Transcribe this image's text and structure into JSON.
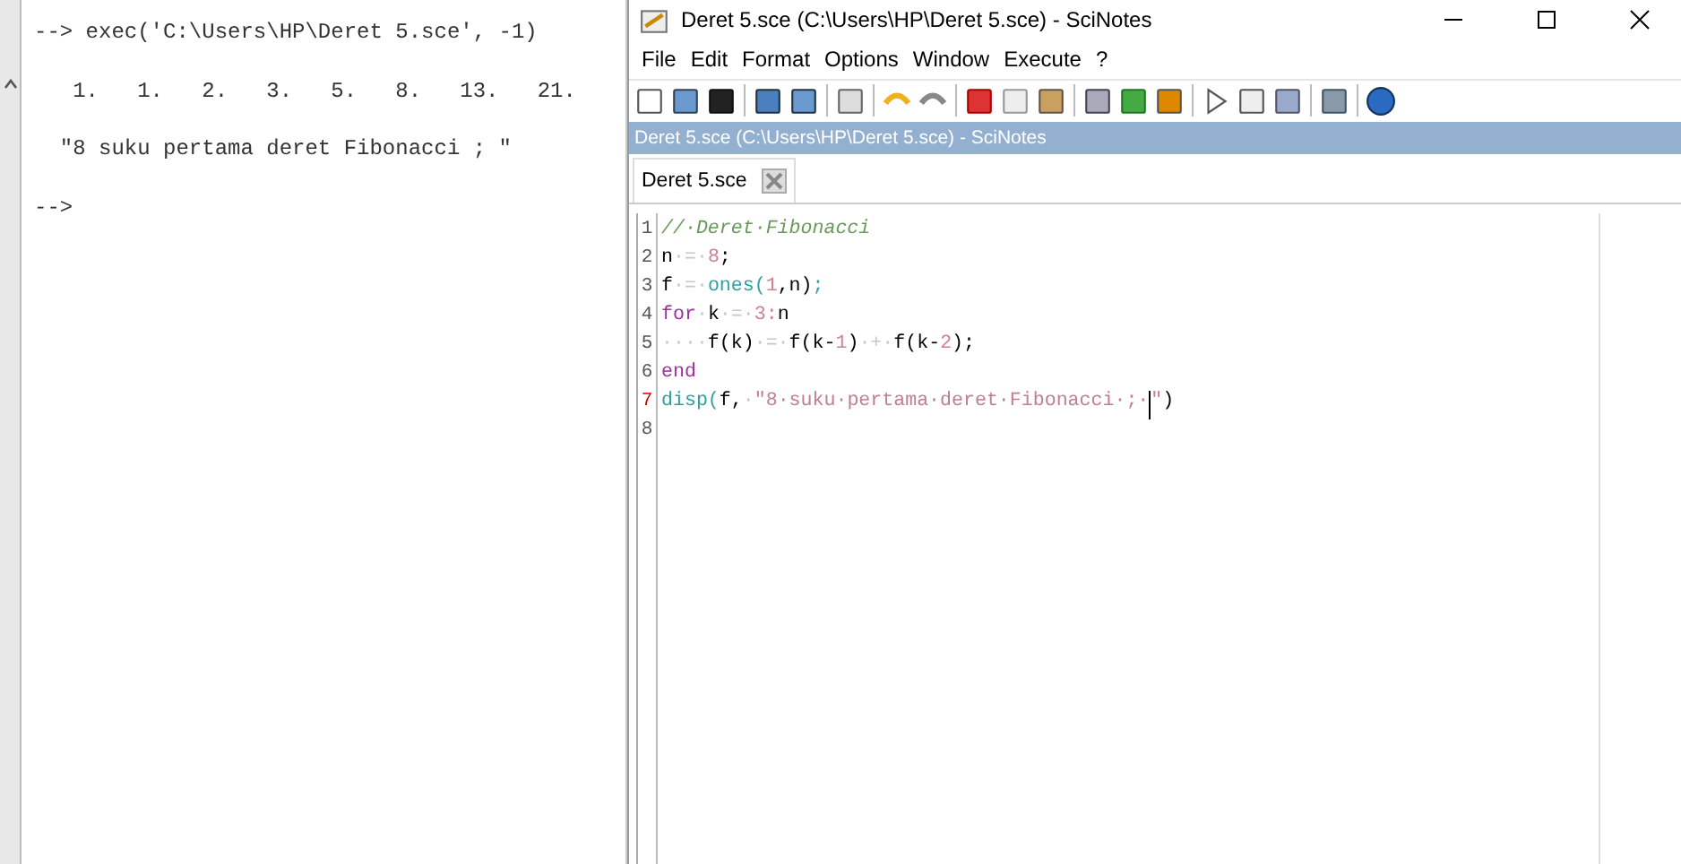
{
  "console": {
    "lines": [
      "--> exec('C:\\Users\\HP\\Deret 5.sce', -1)",
      "   1.   1.   2.   3.   5.   8.   13.   21.",
      "  \"8 suku pertama deret Fibonacci ; \"",
      "-->"
    ]
  },
  "window": {
    "title": "Deret 5.sce (C:\\Users\\HP\\Deret 5.sce) - SciNotes",
    "menu": [
      "File",
      "Edit",
      "Format",
      "Options",
      "Window",
      "Execute",
      "?"
    ],
    "panel_title": "Deret 5.sce (C:\\Users\\HP\\Deret 5.sce) - SciNotes",
    "tabs": [
      {
        "label": "Deret 5.sce",
        "selected": true
      }
    ],
    "editor": {
      "lines": [
        {
          "number": "1",
          "tokens": [
            {
              "kind": "comment",
              "text": "//·Deret·Fibonacci"
            }
          ]
        },
        {
          "number": "2",
          "tokens": [
            {
              "kind": "plain",
              "text": "n"
            },
            {
              "kind": "space",
              "text": "·=·"
            },
            {
              "kind": "number",
              "text": "8"
            },
            {
              "kind": "plain",
              "text": ";"
            }
          ]
        },
        {
          "number": "3",
          "tokens": [
            {
              "kind": "plain",
              "text": "f"
            },
            {
              "kind": "space",
              "text": "·=·"
            },
            {
              "kind": "function",
              "text": "ones("
            },
            {
              "kind": "number",
              "text": "1"
            },
            {
              "kind": "plain",
              "text": ",n)"
            },
            {
              "kind": "function",
              "text": ";"
            }
          ]
        },
        {
          "number": "4",
          "tokens": [
            {
              "kind": "keyword",
              "text": "for"
            },
            {
              "kind": "space",
              "text": "·"
            },
            {
              "kind": "plain",
              "text": "k"
            },
            {
              "kind": "space",
              "text": "·=·"
            },
            {
              "kind": "number",
              "text": "3:"
            },
            {
              "kind": "plain",
              "text": "n"
            }
          ]
        },
        {
          "number": "5",
          "tokens": [
            {
              "kind": "space",
              "text": "····"
            },
            {
              "kind": "plain",
              "text": "f(k)"
            },
            {
              "kind": "space",
              "text": "·=·"
            },
            {
              "kind": "plain",
              "text": "f(k-"
            },
            {
              "kind": "number",
              "text": "1"
            },
            {
              "kind": "plain",
              "text": ")"
            },
            {
              "kind": "space",
              "text": "·+·"
            },
            {
              "kind": "plain",
              "text": "f(k-"
            },
            {
              "kind": "number",
              "text": "2"
            },
            {
              "kind": "plain",
              "text": ");"
            }
          ]
        },
        {
          "number": "6",
          "tokens": [
            {
              "kind": "keyword",
              "text": "end"
            }
          ]
        },
        {
          "number": "7",
          "tokens": [
            {
              "kind": "function",
              "text": "disp("
            },
            {
              "kind": "plain",
              "text": "f,"
            },
            {
              "kind": "space",
              "text": "·"
            },
            {
              "kind": "string",
              "text": "\"8·suku·pertama·deret·Fibonacci·;·"
            },
            {
              "kind": "cursor",
              "text": "\""
            },
            {
              "kind": "plain",
              "text": ")"
            }
          ]
        },
        {
          "number": "8"
        }
      ]
    }
  }
}
